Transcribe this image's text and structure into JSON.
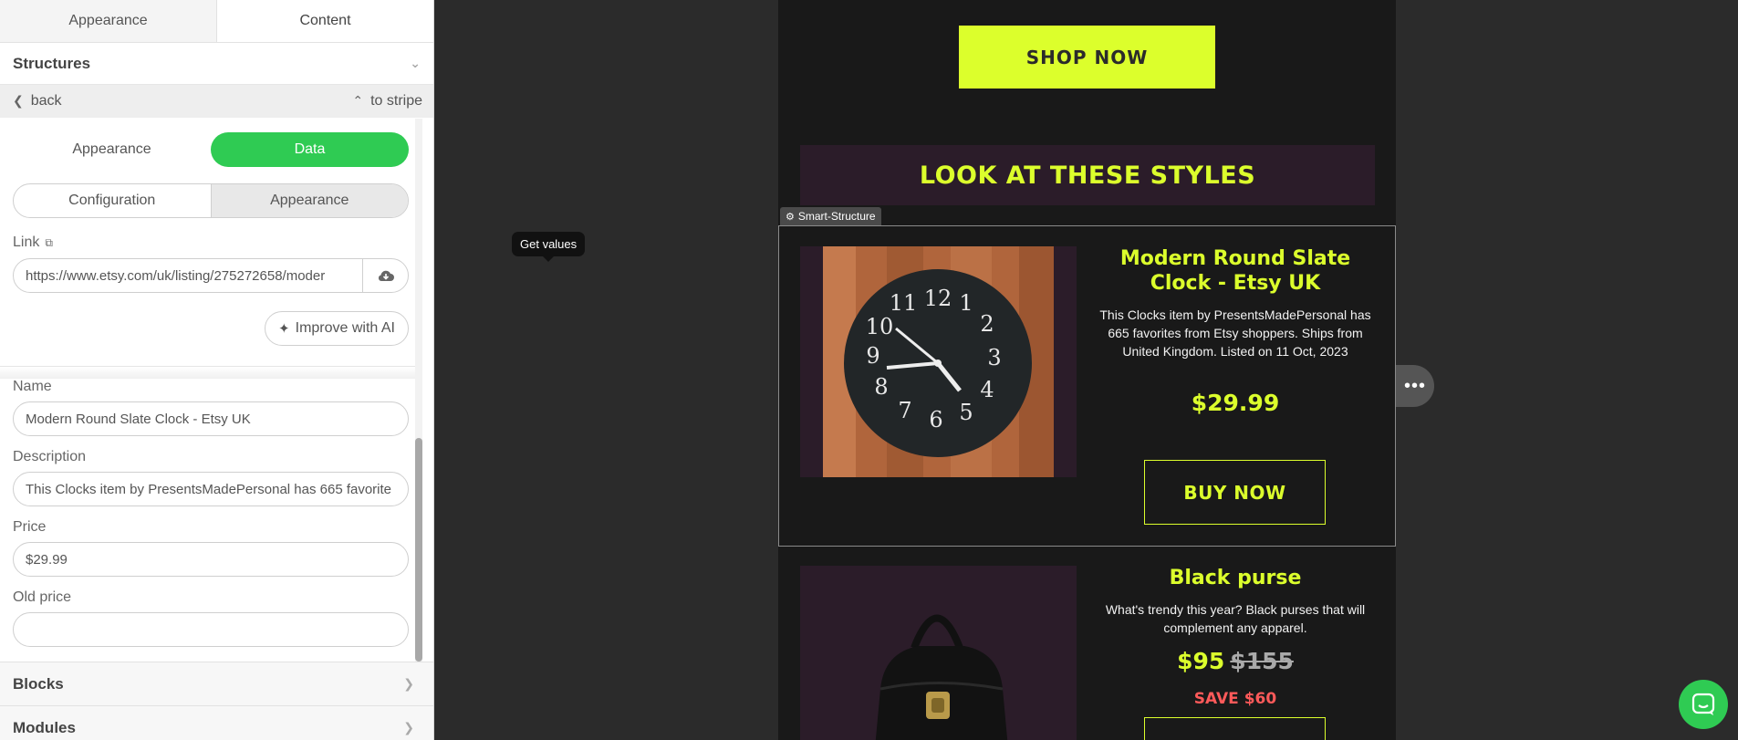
{
  "panel": {
    "tabs": [
      "Appearance",
      "Content"
    ],
    "structures_label": "Structures",
    "back_label": "back",
    "to_stripe_label": "to stripe",
    "mode_tabs": [
      "Appearance",
      "Data"
    ],
    "sub_tabs": [
      "Configuration",
      "Appearance"
    ],
    "link_label": "Link",
    "link_value": "https://www.etsy.com/uk/listing/275272658/moder",
    "improve_ai_label": "Improve with AI",
    "name_label": "Name",
    "name_value": "Modern Round Slate Clock - Etsy UK",
    "description_label": "Description",
    "description_value": "This Clocks item by PresentsMadePersonal has 665 favorite",
    "price_label": "Price",
    "price_value": "$29.99",
    "old_price_label": "Old price",
    "old_price_value": "",
    "blocks_label": "Blocks",
    "modules_label": "Modules"
  },
  "tooltip": "Get values",
  "email": {
    "shop_now": "SHOP NOW",
    "banner_title": "LOOK AT THESE STYLES",
    "smart_structure_tag": "Smart-Structure",
    "product1": {
      "title": "Modern Round Slate Clock - Etsy UK",
      "description": "This Clocks item by PresentsMadePersonal has 665 favorites from Etsy shoppers. Ships from United Kingdom. Listed on 11 Oct, 2023",
      "price": "$29.99",
      "button": "BUY NOW"
    },
    "product2": {
      "title": "Black purse",
      "description": "What's trendy this year? Black purses that will complement any apparel.",
      "price": "$95",
      "old_price": "$155",
      "save": "SAVE $60"
    }
  },
  "colors": {
    "accent_green": "#2fcb53",
    "email_lime": "#dcff2c",
    "email_bg": "#191919",
    "save_red": "#ff5a5a"
  }
}
